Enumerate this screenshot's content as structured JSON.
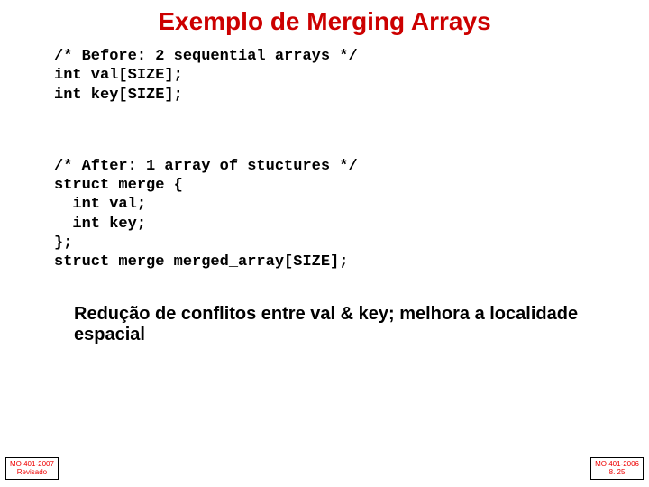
{
  "title": "Exemplo de Merging Arrays",
  "code_before": "/* Before: 2 sequential arrays */\nint val[SIZE];\nint key[SIZE];",
  "code_after": "/* After: 1 array of stuctures */\nstruct merge {\n  int val;\n  int key;\n};\nstruct merge merged_array[SIZE];",
  "summary": "Redução de conflitos entre val & key; melhora a localidade espacial",
  "footer_left_line1": "MO 401-2007",
  "footer_left_line2": "Revisado",
  "footer_right_line1": "MO 401-2006",
  "footer_right_line2": "8. 25"
}
